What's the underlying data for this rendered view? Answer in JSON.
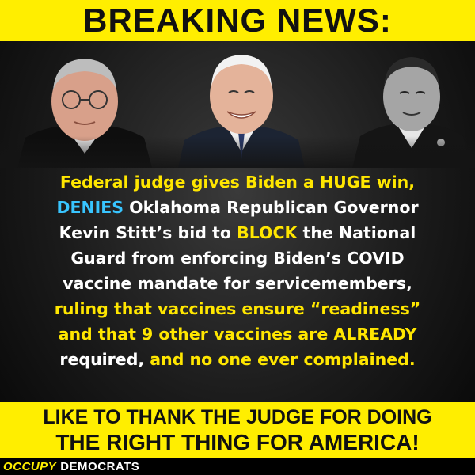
{
  "header": {
    "title": "BREAKING NEWS:"
  },
  "photos": [
    {
      "name": "judge-photo"
    },
    {
      "name": "biden-photo"
    },
    {
      "name": "stitt-photo"
    }
  ],
  "body": {
    "lines": [
      [
        {
          "text": "Federal judge gives Biden a HUGE win,",
          "style": "yellow"
        }
      ],
      [
        {
          "text": "DENIES",
          "style": "blue"
        },
        {
          "text": " Oklahoma Republican Governor",
          "style": "white"
        }
      ],
      [
        {
          "text": "Kevin Stitt’s bid to ",
          "style": "white"
        },
        {
          "text": "BLOCK",
          "style": "yellow"
        },
        {
          "text": " the National",
          "style": "white"
        }
      ],
      [
        {
          "text": "Guard from enforcing Biden’s COVID",
          "style": "white"
        }
      ],
      [
        {
          "text": "vaccine mandate for servicemembers,",
          "style": "white"
        }
      ],
      [
        {
          "text": "ruling that vaccines ensure “readiness”",
          "style": "yellow"
        }
      ],
      [
        {
          "text": "and that 9 other vaccines are ALREADY",
          "style": "yellow"
        }
      ],
      [
        {
          "text": "required, ",
          "style": "white"
        },
        {
          "text": "and no one ever complained.",
          "style": "yellow"
        }
      ]
    ]
  },
  "cta": {
    "line1": "LIKE TO THANK THE JUDGE FOR DOING",
    "line2": "THE RIGHT THING FOR AMERICA!"
  },
  "footer": {
    "brand_part1": "OCCUPY",
    "brand_part2": "DEMOCRATS"
  },
  "colors": {
    "banner": "#ffee00",
    "highlight_yellow": "#ffe600",
    "highlight_blue": "#38c5ff",
    "text": "#ffffff"
  }
}
